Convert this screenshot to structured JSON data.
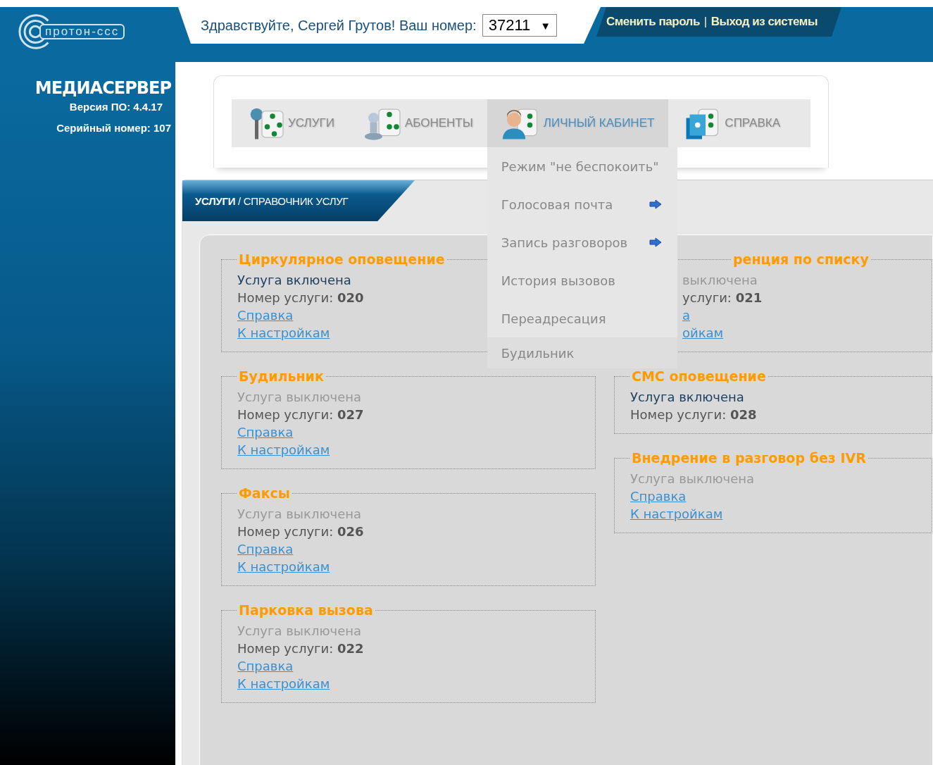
{
  "logo": {
    "text": "протон-ссс"
  },
  "app": {
    "title": "МЕДИАСЕРВЕР",
    "version": "Версия ПО: 4.4.17",
    "serial": "Серийный номер: 107"
  },
  "header": {
    "greeting": "Здравствуйте, Сергей Грутов! Ваш номер:",
    "number_select": {
      "value": "37211",
      "arrow": "▼"
    },
    "links": [
      "Сменить пароль",
      "Выход из системы"
    ],
    "separator": "|"
  },
  "nav_tabs": [
    {
      "label": "УСЛУГИ",
      "kind": "services",
      "selected": false
    },
    {
      "label": "АБОНЕНТЫ",
      "kind": "subscribers",
      "selected": false
    },
    {
      "label": "ЛИЧНЫЙ КАБИНЕТ",
      "kind": "cabinet",
      "selected": true
    },
    {
      "label": "СПРАВКА",
      "kind": "help",
      "selected": false
    }
  ],
  "dropdown": {
    "items": [
      {
        "label": "Режим \"не беспокоить\"",
        "kind": "plain",
        "selected": false
      },
      {
        "label": "Голосовая почта",
        "kind": "submenu",
        "selected": false
      },
      {
        "label": "Запись разговоров",
        "kind": "submenu",
        "selected": false
      },
      {
        "label": "История вызовов",
        "kind": "plain",
        "selected": false
      },
      {
        "label": "Переадресация",
        "kind": "plain",
        "selected": false
      },
      {
        "label": "Будильник",
        "kind": "plain",
        "selected": true
      }
    ]
  },
  "breadcrumb": "**УСЛУГИ** / СПРАВОЧНИК УСЛУГ",
  "cards": {
    "left": [
      {
        "title": "Циркулярное оповещение",
        "status": "Услуга включена",
        "enabled": true,
        "number": "Номер услуги: **020**",
        "links": [
          "Справка",
          "К настройкам"
        ]
      },
      {
        "title": "Будильник",
        "status": "Услуга выключена",
        "enabled": false,
        "number": "Номер услуги: **027**",
        "links": [
          "Справка",
          "К настройкам"
        ]
      },
      {
        "title": "Факсы",
        "status": "Услуга выключена",
        "enabled": false,
        "number": "Номер услуги: **026**",
        "links": [
          "Справка",
          "К настройкам"
        ]
      },
      {
        "title": "Парковка вызова",
        "status": "Услуга выключена",
        "enabled": false,
        "number": "Номер услуги: **022**",
        "links": [
          "Справка",
          "К настройкам"
        ]
      }
    ],
    "right": [
      {
        "title": "ренция по списку",
        "status": "выключена",
        "enabled": false,
        "number": "услуги: **021**",
        "links": [
          "а",
          "ойкам"
        ],
        "covered": true
      },
      {
        "title": "СМС оповещение",
        "status": "Услуга включена",
        "enabled": true,
        "number": "Номер услуги: **028**"
      },
      {
        "title": "Внедрение в разговор без IVR",
        "status": "Услуга выключена",
        "enabled": false,
        "links": [
          "Справка",
          "К настройкам"
        ]
      }
    ]
  }
}
